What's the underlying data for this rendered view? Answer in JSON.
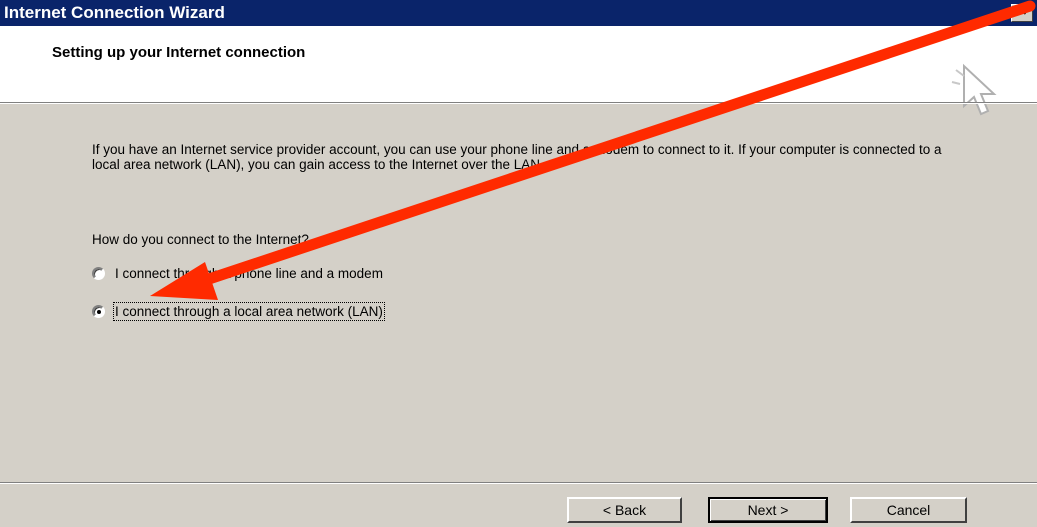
{
  "window": {
    "title": "Internet Connection Wizard",
    "close_label": "×"
  },
  "header": {
    "heading": "Setting up your Internet connection",
    "icon": "cursor-icon"
  },
  "body": {
    "intro": "If you have an Internet service provider account, you can use your phone line and a modem to connect to it. If your computer is connected to a local area network (LAN), you can gain access to the Internet over the LAN.",
    "question": "How do you connect to the Internet?",
    "options": [
      {
        "label": "I connect through a phone line and a modem",
        "checked": false
      },
      {
        "label": "I connect through a local area network (LAN)",
        "checked": true
      }
    ]
  },
  "buttons": {
    "back": "< Back",
    "next": "Next >",
    "cancel": "Cancel"
  },
  "annotation": {
    "color": "#ff2a00"
  }
}
